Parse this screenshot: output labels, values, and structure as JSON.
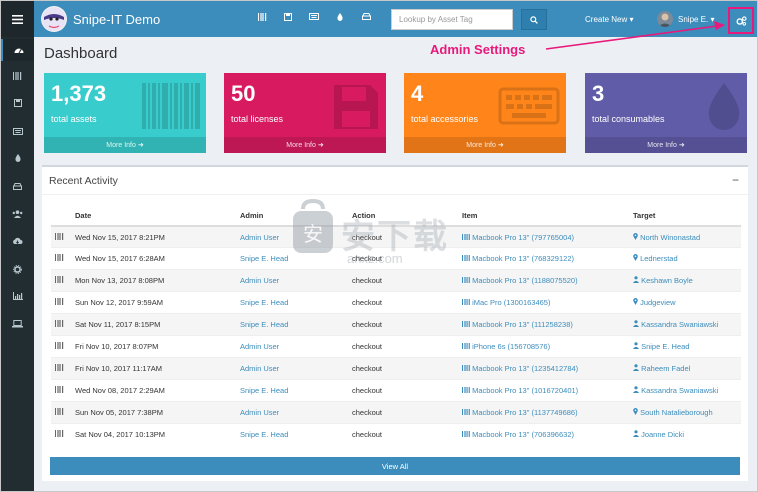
{
  "app": {
    "title": "Snipe-IT Demo"
  },
  "header": {
    "menu_icon": "hamburger-icon",
    "nav_icons": [
      "barcode-icon",
      "save-icon",
      "keyboard-icon",
      "tint-icon",
      "hdd-icon"
    ],
    "search_placeholder": "Lookup by Asset Tag",
    "create_new": "Create New",
    "user_name": "Snipe E.",
    "settings_icon": "gears-icon"
  },
  "annotation": {
    "text": "Admin Settings",
    "color": "#e8197a"
  },
  "sidebar": {
    "items": [
      "dashboard-icon",
      "barcode-icon",
      "save-icon",
      "keyboard-icon",
      "tint-icon",
      "hdd-icon",
      "users-icon",
      "cloud-download-icon",
      "cog-icon",
      "bar-chart-icon",
      "laptop-icon"
    ]
  },
  "page": {
    "title": "Dashboard"
  },
  "stats": [
    {
      "value": "1,373",
      "label": "total assets",
      "more": "More Info",
      "color": "#39cccc"
    },
    {
      "value": "50",
      "label": "total licenses",
      "more": "More Info",
      "color": "#d81b60"
    },
    {
      "value": "4",
      "label": "total accessories",
      "more": "More Info",
      "color": "#ff851b"
    },
    {
      "value": "3",
      "label": "total consumables",
      "more": "More Info",
      "color": "#605ca8"
    }
  ],
  "activity": {
    "title": "Recent Activity",
    "collapse": "−",
    "columns": [
      "Date",
      "Admin",
      "Action",
      "Item",
      "Target"
    ],
    "rows": [
      {
        "date": "Wed Nov 15, 2017 8:21PM",
        "admin": "Admin User",
        "action": "checkout",
        "item": "Macbook Pro 13\" (797765004)",
        "target": "North Winonastad",
        "target_icon": "map-marker-icon"
      },
      {
        "date": "Wed Nov 15, 2017 6:28AM",
        "admin": "Snipe E. Head",
        "action": "checkout",
        "item": "Macbook Pro 13\" (768329122)",
        "target": "Lednerstad",
        "target_icon": "map-marker-icon"
      },
      {
        "date": "Mon Nov 13, 2017 8:08PM",
        "admin": "Admin User",
        "action": "checkout",
        "item": "Macbook Pro 13\" (1188075520)",
        "target": "Keshawn Boyle",
        "target_icon": "user-icon"
      },
      {
        "date": "Sun Nov 12, 2017 9:59AM",
        "admin": "Snipe E. Head",
        "action": "checkout",
        "item": "iMac Pro (1300163465)",
        "target": "Judgeview",
        "target_icon": "map-marker-icon"
      },
      {
        "date": "Sat Nov 11, 2017 8:15PM",
        "admin": "Snipe E. Head",
        "action": "checkout",
        "item": "Macbook Pro 13\" (111258238)",
        "target": "Kassandra Swaniawski",
        "target_icon": "user-icon"
      },
      {
        "date": "Fri Nov 10, 2017 8:07PM",
        "admin": "Admin User",
        "action": "checkout",
        "item": "iPhone 6s (156708576)",
        "target": "Snipe E. Head",
        "target_icon": "user-icon"
      },
      {
        "date": "Fri Nov 10, 2017 11:17AM",
        "admin": "Admin User",
        "action": "checkout",
        "item": "Macbook Pro 13\" (1235412784)",
        "target": "Raheem Fadel",
        "target_icon": "user-icon"
      },
      {
        "date": "Wed Nov 08, 2017 2:29AM",
        "admin": "Snipe E. Head",
        "action": "checkout",
        "item": "Macbook Pro 13\" (1016720401)",
        "target": "Kassandra Swaniawski",
        "target_icon": "user-icon"
      },
      {
        "date": "Sun Nov 05, 2017 7:38PM",
        "admin": "Admin User",
        "action": "checkout",
        "item": "Macbook Pro 13\" (1137749686)",
        "target": "South Natalieborough",
        "target_icon": "map-marker-icon"
      },
      {
        "date": "Sat Nov 04, 2017 10:13PM",
        "admin": "Snipe E. Head",
        "action": "checkout",
        "item": "Macbook Pro 13\" (706396632)",
        "target": "Joanne Dicki",
        "target_icon": "user-icon"
      }
    ],
    "view_all": "View All"
  },
  "watermark": {
    "text": "安下载",
    "sub": "anxz.com"
  }
}
